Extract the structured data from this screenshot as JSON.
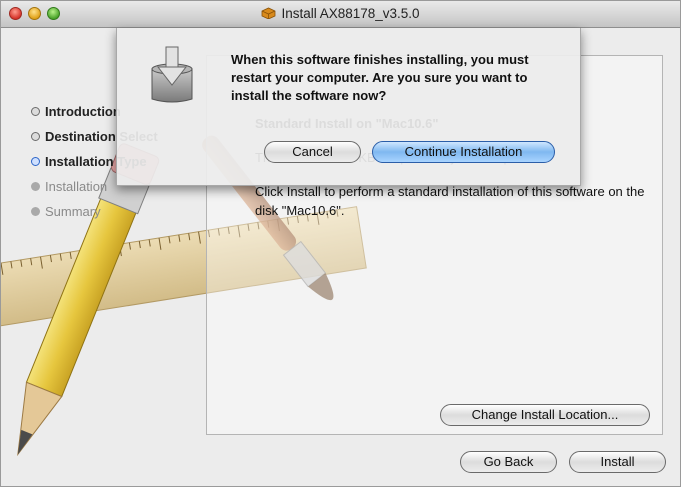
{
  "window": {
    "title": "Install AX88178_v3.5.0",
    "buttons": {
      "close": "close",
      "minimize": "minimize",
      "zoom": "zoom"
    }
  },
  "sidebar": {
    "steps": [
      {
        "label": "Introduction",
        "state": "done"
      },
      {
        "label": "Destination Select",
        "state": "done"
      },
      {
        "label": "Installation Type",
        "state": "current"
      },
      {
        "label": "Installation",
        "state": "future"
      },
      {
        "label": "Summary",
        "state": "future"
      }
    ]
  },
  "panel": {
    "heading": "Standard Install on \"Mac10.6\"",
    "line1": "This will take 214 KB of space on your computer.",
    "line2": "Click Install to perform a standard installation of this software on the disk \"Mac10.6\"."
  },
  "buttons": {
    "change_location": "Change Install Location...",
    "go_back": "Go Back",
    "install": "Install"
  },
  "dialog": {
    "message": "When this software finishes installing, you must restart your computer. Are you sure you want to install the software now?",
    "cancel": "Cancel",
    "continue": "Continue Installation",
    "icon": "installer-package-icon"
  },
  "colors": {
    "accent": "#2c65c8",
    "primary_button": "#7fb8f0"
  }
}
